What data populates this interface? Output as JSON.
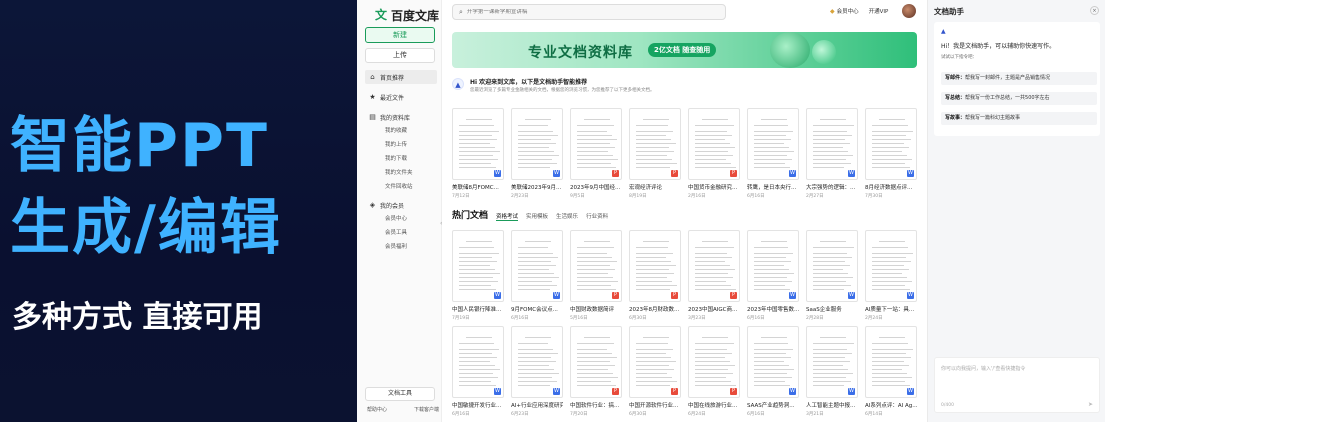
{
  "promo": {
    "line1": "智能PPT",
    "line2": "生成/编辑",
    "sub": "多种方式 直接可用"
  },
  "app": {
    "logo": "百度文库",
    "sidebar": {
      "new_label": "新建",
      "upload_label": "上传",
      "items": [
        {
          "label": "首页推荐",
          "icon": "home-icon"
        },
        {
          "label": "最近文件",
          "icon": "star-icon"
        },
        {
          "label": "我的资料库",
          "icon": "folder-icon"
        }
      ],
      "library_sub": [
        "我的收藏",
        "我的上传",
        "我的下载",
        "我的文件夹",
        "文件回收站"
      ],
      "member": {
        "label": "我的会员",
        "icon": "shield-icon"
      },
      "member_sub": [
        "会员中心",
        "会员工具",
        "会员福利"
      ],
      "tools_label": "文档工具",
      "footer": [
        "帮助中心",
        "下载客户端"
      ]
    },
    "topbar": {
      "search_placeholder": "开学第一课新学期宣讲稿",
      "member_center": "会员中心",
      "open_vip": "开通VIP"
    },
    "banner": {
      "title": "专业文档资料库",
      "pill": "2亿文档 随查随用"
    },
    "recommend": {
      "title": "Hi 欢迎来到文库，以下是文档助手智能推荐",
      "desc": "您最近浏览了多篇专业金融相关的文档，根据您的浏览习惯，为您推荐了以下更多相关文档。"
    },
    "rec_docs": [
      {
        "name": "美联储8月FOMC...",
        "date": "7月12日",
        "type": "w"
      },
      {
        "name": "美联储2023年9月...",
        "date": "2月23日",
        "type": "w"
      },
      {
        "name": "2023年9月中国经...",
        "date": "9月5日",
        "type": "p"
      },
      {
        "name": "宏观经济评论",
        "date": "8月19日",
        "type": "p"
      },
      {
        "name": "中国货币金融研究...",
        "date": "2月16日",
        "type": "p"
      },
      {
        "name": "转鹰，是日本央行...",
        "date": "6月16日",
        "type": "w"
      },
      {
        "name": "大宗强势的逻辑：...",
        "date": "2月27日",
        "type": "w"
      },
      {
        "name": "8月经济数据点评...",
        "date": "7月30日",
        "type": "w"
      }
    ],
    "hot": {
      "title": "热门文档",
      "tabs": [
        "资格考试",
        "实用模板",
        "生活娱乐",
        "行业资料"
      ]
    },
    "hot_docs_row1": [
      {
        "name": "中国人民银行降准...",
        "date": "7月19日",
        "type": "w"
      },
      {
        "name": "9月FOMC会议点...",
        "date": "6月16日",
        "type": "w"
      },
      {
        "name": "中国财政数据简评",
        "date": "5月16日",
        "type": "p"
      },
      {
        "name": "2023年8月财政数...",
        "date": "6月30日",
        "type": "p"
      },
      {
        "name": "2023中国AIGC商...",
        "date": "3月23日",
        "type": "p"
      },
      {
        "name": "2023年中国零售数...",
        "date": "6月16日",
        "type": "w"
      },
      {
        "name": "SaaS企业服务",
        "date": "2月28日",
        "type": "w"
      },
      {
        "name": "AI质量下一站：具...",
        "date": "2月24日",
        "type": "w"
      }
    ],
    "hot_docs_row2": [
      {
        "name": "中国敏捷开发行业...",
        "date": "6月16日",
        "type": "w"
      },
      {
        "name": "AI+行业应用深度研究",
        "date": "6月23日",
        "type": "w"
      },
      {
        "name": "中国软件行业：搞...",
        "date": "7月20日",
        "type": "p"
      },
      {
        "name": "中国开源软件行业...",
        "date": "6月30日",
        "type": "p"
      },
      {
        "name": "中国在线旅游行业...",
        "date": "6月24日",
        "type": "p"
      },
      {
        "name": "SAAS产业趋势洞...",
        "date": "6月16日",
        "type": "w"
      },
      {
        "name": "人工智能主题中报...",
        "date": "3月21日",
        "type": "w"
      },
      {
        "name": "AI系列点评：AI Ag...",
        "date": "6月14日",
        "type": "w"
      }
    ],
    "assistant": {
      "title": "文档助手",
      "greeting": "Hi！我是文档助手，可以辅助你快速写作。",
      "hint": "试试以下指令吧：",
      "suggestions": [
        {
          "tag": "写邮件：",
          "text": "帮我写一封邮件，主题是产品销售情况"
        },
        {
          "tag": "写总结：",
          "text": "帮我写一份工作总结，一共500字左右"
        },
        {
          "tag": "写故事：",
          "text": "帮我写一篇科幻主题故事"
        }
      ],
      "input_placeholder": "你可以向我提问，输入'/'查看快捷指令",
      "counter": "0/400"
    }
  }
}
